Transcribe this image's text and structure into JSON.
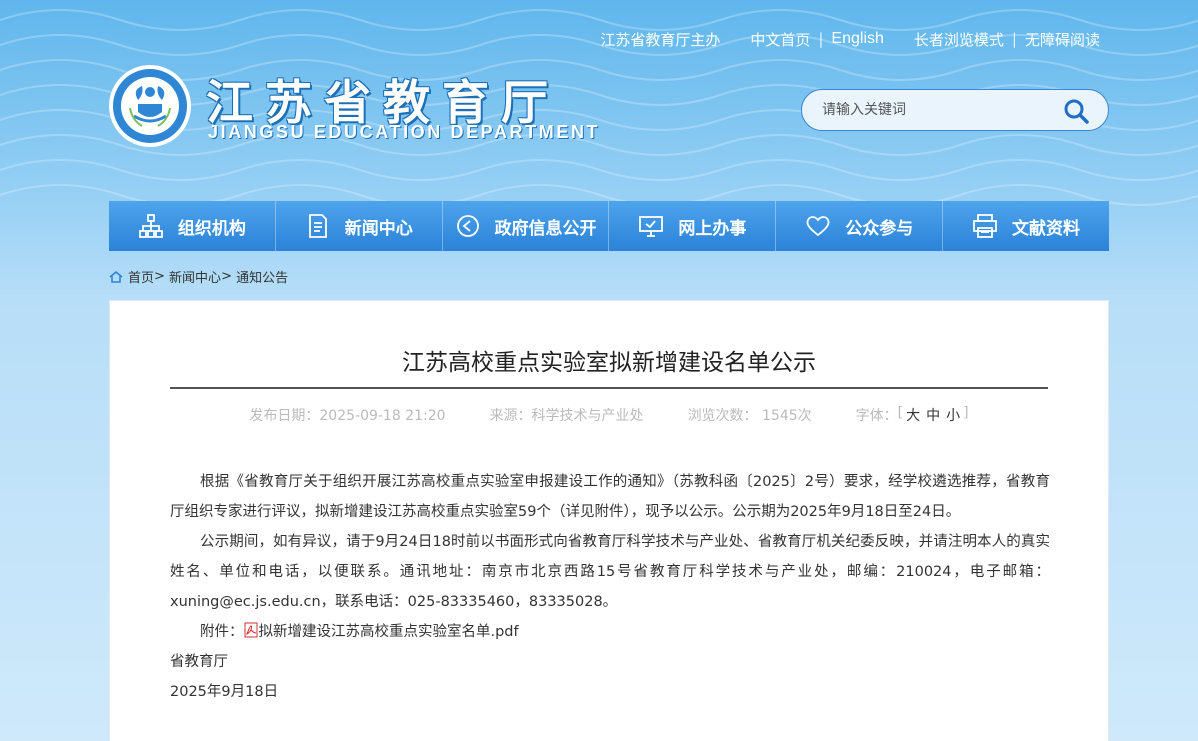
{
  "topbar": {
    "sponsor": "江苏省教育厅主办",
    "home_cn": "中文首页",
    "english": "English",
    "elder_mode": "长者浏览模式",
    "accessible": "无障碍阅读"
  },
  "header": {
    "title": "江苏省教育厅",
    "subtitle": "JIANGSU EDUCATION DEPARTMENT"
  },
  "search": {
    "placeholder": "请输入关键词"
  },
  "nav": [
    {
      "label": "组织机构",
      "icon": "org-chart-icon"
    },
    {
      "label": "新闻中心",
      "icon": "document-icon"
    },
    {
      "label": "政府信息公开",
      "icon": "play-circle-icon"
    },
    {
      "label": "网上办事",
      "icon": "monitor-icon"
    },
    {
      "label": "公众参与",
      "icon": "heart-icon"
    },
    {
      "label": "文献资料",
      "icon": "printer-icon"
    }
  ],
  "breadcrumb": {
    "home": "首页",
    "news": "新闻中心",
    "notice": "通知公告"
  },
  "article": {
    "title": "江苏高校重点实验室拟新增建设名单公示",
    "date_label": "发布日期：2025-09-18 21:20",
    "source_label": "来源：科学技术与产业处",
    "views_label": "浏览次数：  1545次",
    "font_label": "字体：",
    "font_large": "大",
    "font_medium": "中",
    "font_small": "小",
    "para1": "根据《省教育厅关于组织开展江苏高校重点实验室申报建设工作的通知》（苏教科函〔2025〕2号）要求，经学校遴选推荐，省教育厅组织专家进行评议，拟新增建设江苏高校重点实验室59个（详见附件），现予以公示。公示期为2025年9月18日至24日。",
    "para2": "公示期间，如有异议，请于9月24日18时前以书面形式向省教育厅科学技术与产业处、省教育厅机关纪委反映，并请注明本人的真实姓名、单位和电话，以便联系。通讯地址：南京市北京西路15号省教育厅科学技术与产业处，邮编：210024，电子邮箱：xuning@ec.js.edu.cn，联系电话：025-83335460，83335028。",
    "attach_label": "附件：",
    "attach_file": "拟新增建设江苏高校重点实验室名单.pdf",
    "signature": "省教育厅",
    "sign_date": "2025年9月18日"
  },
  "colors": {
    "nav_bg": "#2b82d8",
    "accent": "#3b86d6"
  }
}
